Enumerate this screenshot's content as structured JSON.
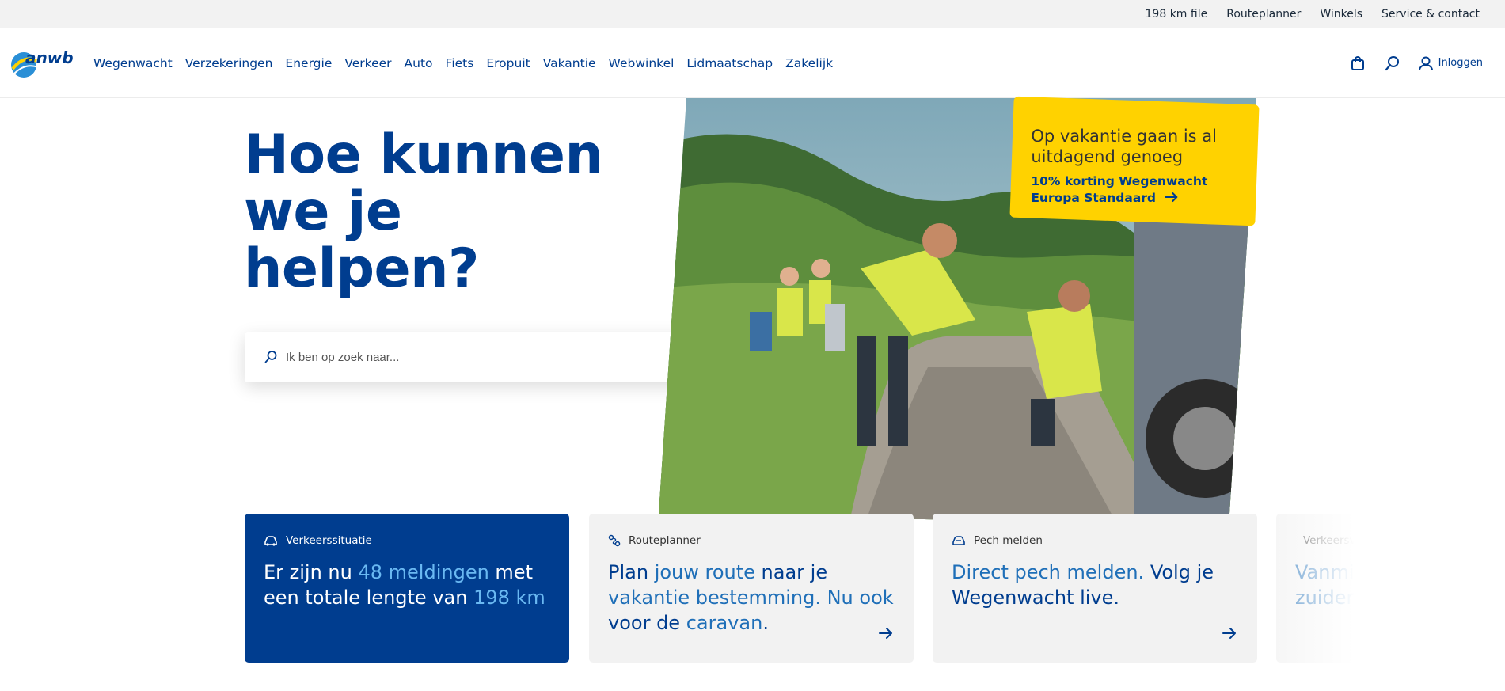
{
  "topbar": {
    "links": [
      "198 km file",
      "Routeplanner",
      "Winkels",
      "Service & contact"
    ]
  },
  "logo": {
    "text": "anwb"
  },
  "nav": {
    "items": [
      "Wegenwacht",
      "Verzekeringen",
      "Energie",
      "Verkeer",
      "Auto",
      "Fiets",
      "Eropuit",
      "Vakantie",
      "Webwinkel",
      "Lidmaatschap",
      "Zakelijk"
    ]
  },
  "header": {
    "login_label": "Inloggen"
  },
  "hero": {
    "title_lines": [
      "Hoe kunnen",
      "we je",
      "helpen?"
    ]
  },
  "search": {
    "placeholder": "Ik ben op zoek naar..."
  },
  "promo": {
    "title": "Op vakantie gaan is al uitdagend genoeg",
    "link_line1": "10% korting Wegenwacht",
    "link_line2": "Europa Standaard"
  },
  "cards": [
    {
      "label": "Verkeerssituatie",
      "t1": "Er zijn nu ",
      "h1": "48 meldingen",
      "t2": " met een totale lengte van ",
      "h2": "198 km"
    },
    {
      "label": "Routeplanner",
      "t1": "Plan ",
      "h1": "jouw route",
      "t2": " naar je ",
      "h2": "vakantie bestemming. Nu ook",
      "t3": " voor de ",
      "h3": "caravan",
      "t4": "."
    },
    {
      "label": "Pech melden",
      "h1": "Direct pech melden.",
      "t1": " Volg je Wegenwacht live."
    },
    {
      "label": "Verkeersverwachting",
      "text": "Vanmiddag spits. Meer zuiden"
    }
  ],
  "colors": {
    "brand_blue": "#003d8f",
    "promo_yellow": "#ffd200",
    "highlight_light": "#6ab9f2",
    "card_grey": "#f2f2f2"
  }
}
